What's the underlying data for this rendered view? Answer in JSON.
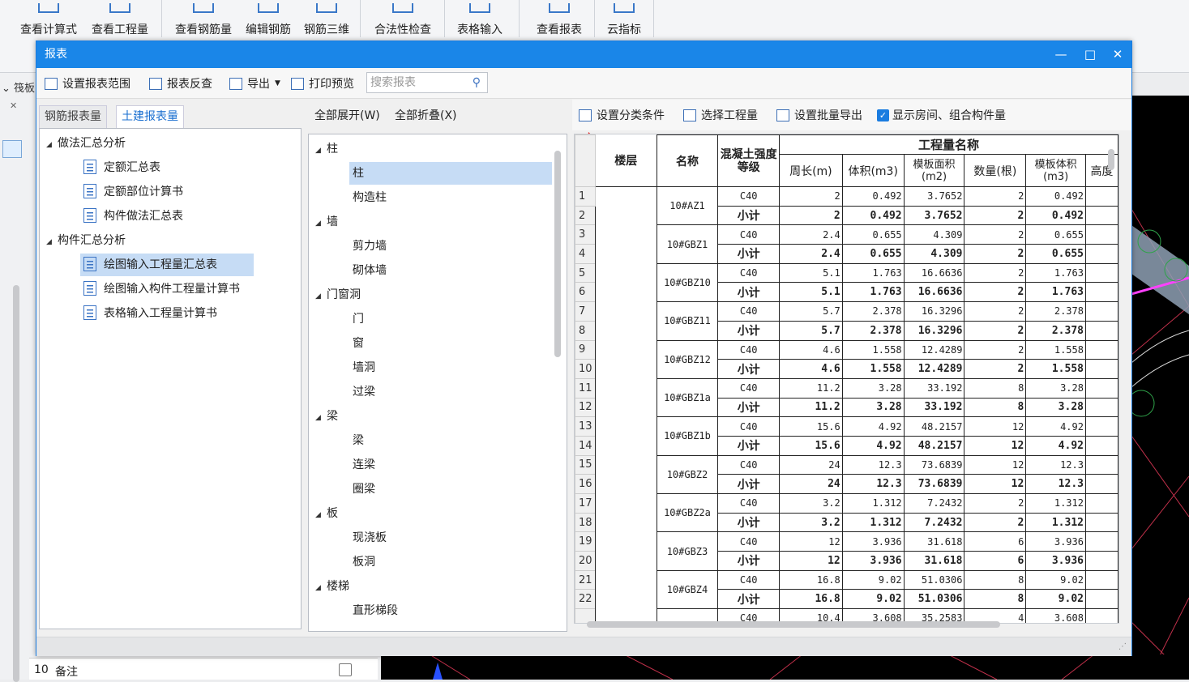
{
  "ribbon": {
    "items": [
      "查看计算式",
      "查看工程量",
      "查看钢筋量",
      "编辑钢筋",
      "钢筋三维",
      "合法性检查",
      "表格输入",
      "查看报表",
      "云指标"
    ]
  },
  "window": {
    "title": "报表",
    "minimize": "—",
    "maximize": "□",
    "close": "✕"
  },
  "toolbar": {
    "set_scope": "设置报表范围",
    "reverse_check": "报表反查",
    "export": "导出",
    "print_preview": "打印预览",
    "search_placeholder": "搜索报表"
  },
  "side_label": "筏板",
  "left": {
    "tab_rebar": "钢筋报表量",
    "tab_civil": "土建报表量",
    "tree": [
      {
        "label": "做法汇总分析",
        "group": true
      },
      {
        "label": "定额汇总表"
      },
      {
        "label": "定额部位计算书"
      },
      {
        "label": "构件做法汇总表"
      },
      {
        "label": "构件汇总分析",
        "group": true
      },
      {
        "label": "绘图输入工程量汇总表",
        "selected": true
      },
      {
        "label": "绘图输入构件工程量计算书"
      },
      {
        "label": "表格输入工程量计算书"
      }
    ]
  },
  "middle": {
    "expand_all": "全部展开(W)",
    "collapse_all": "全部折叠(X)",
    "tree": [
      {
        "label": "柱",
        "group": true
      },
      {
        "label": "柱",
        "selected": true
      },
      {
        "label": "构造柱"
      },
      {
        "label": "墙",
        "group": true
      },
      {
        "label": "剪力墙"
      },
      {
        "label": "砌体墙"
      },
      {
        "label": "门窗洞",
        "group": true
      },
      {
        "label": "门"
      },
      {
        "label": "窗"
      },
      {
        "label": "墙洞"
      },
      {
        "label": "过梁"
      },
      {
        "label": "梁",
        "group": true
      },
      {
        "label": "梁"
      },
      {
        "label": "连梁"
      },
      {
        "label": "圈梁"
      },
      {
        "label": "板",
        "group": true
      },
      {
        "label": "现浇板"
      },
      {
        "label": "板洞"
      },
      {
        "label": "楼梯",
        "group": true
      },
      {
        "label": "直形梯段"
      }
    ]
  },
  "right": {
    "set_category": "设置分类条件",
    "select_qty": "选择工程量",
    "batch_export": "设置批量导出",
    "show_room": "显示房间、组合构件量"
  },
  "table": {
    "headers": {
      "floor": "楼层",
      "name": "名称",
      "grade": "混凝土强度等级",
      "group": "工程量名称",
      "perimeter": "周长(m)",
      "volume": "体积(m3)",
      "form_area": "模板面积(m2)",
      "count": "数量(根)",
      "form_volume": "模板体积(m3)",
      "height": "高度"
    },
    "subtotal": "小计",
    "rows": [
      {
        "name": "10#AZ1",
        "grade": "C40",
        "p": "2",
        "v": "0.492",
        "fa": "3.7652",
        "n": "2",
        "fv": "0.492"
      },
      {
        "name": "10#GBZ1",
        "grade": "C40",
        "p": "2.4",
        "v": "0.655",
        "fa": "4.309",
        "n": "2",
        "fv": "0.655"
      },
      {
        "name": "10#GBZ10",
        "grade": "C40",
        "p": "5.1",
        "v": "1.763",
        "fa": "16.6636",
        "n": "2",
        "fv": "1.763"
      },
      {
        "name": "10#GBZ11",
        "grade": "C40",
        "p": "5.7",
        "v": "2.378",
        "fa": "16.3296",
        "n": "2",
        "fv": "2.378"
      },
      {
        "name": "10#GBZ12",
        "grade": "C40",
        "p": "4.6",
        "v": "1.558",
        "fa": "12.4289",
        "n": "2",
        "fv": "1.558"
      },
      {
        "name": "10#GBZ1a",
        "grade": "C40",
        "p": "11.2",
        "v": "3.28",
        "fa": "33.192",
        "n": "8",
        "fv": "3.28"
      },
      {
        "name": "10#GBZ1b",
        "grade": "C40",
        "p": "15.6",
        "v": "4.92",
        "fa": "48.2157",
        "n": "12",
        "fv": "4.92"
      },
      {
        "name": "10#GBZ2",
        "grade": "C40",
        "p": "24",
        "v": "12.3",
        "fa": "73.6839",
        "n": "12",
        "fv": "12.3"
      },
      {
        "name": "10#GBZ2a",
        "grade": "C40",
        "p": "3.2",
        "v": "1.312",
        "fa": "7.2432",
        "n": "2",
        "fv": "1.312"
      },
      {
        "name": "10#GBZ3",
        "grade": "C40",
        "p": "12",
        "v": "3.936",
        "fa": "31.618",
        "n": "6",
        "fv": "3.936"
      },
      {
        "name": "10#GBZ4",
        "grade": "C40",
        "p": "16.8",
        "v": "9.02",
        "fa": "51.0306",
        "n": "8",
        "fv": "9.02"
      }
    ],
    "partial_row": {
      "p": "10.4",
      "v": "3.608",
      "fa": "35.2583",
      "n": "4",
      "fv": "3.608"
    }
  },
  "bottom": {
    "row_no": "10",
    "label": "备注"
  }
}
